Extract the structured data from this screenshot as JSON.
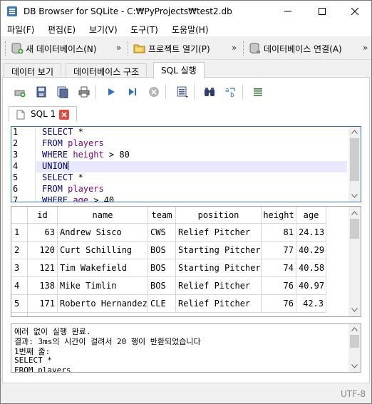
{
  "window": {
    "title": "DB Browser for SQLite - C:₩PyProjects₩test2.db"
  },
  "menu": [
    {
      "label": "파일(F)"
    },
    {
      "label": "편집(E)"
    },
    {
      "label": "보기(V)"
    },
    {
      "label": "도구(T)"
    },
    {
      "label": "도움말(H)"
    }
  ],
  "toolbar": {
    "new_db": "새 데이터베이스(N)",
    "open_project": "프로젝트 열기(P)",
    "attach_db": "데이터베이스 연결(A)",
    "overflow": "»"
  },
  "tabs": [
    {
      "label": "데이터 보기"
    },
    {
      "label": "데이터베이스 구조"
    },
    {
      "label": "SQL 실행"
    }
  ],
  "sql_tab": {
    "label": "SQL 1"
  },
  "editor": {
    "line_numbers": [
      "1",
      "2",
      "3",
      "4",
      "5",
      "6",
      "7"
    ],
    "lines": [
      {
        "kw": "SELECT",
        "rest": " *"
      },
      {
        "kw": "FROM",
        "tbl": " players"
      },
      {
        "kw": "WHERE",
        "col": " height",
        "rest": " > 80"
      },
      {
        "kw": "UNION"
      },
      {
        "kw": "SELECT",
        "rest": " *"
      },
      {
        "kw": "FROM",
        "tbl": " players"
      },
      {
        "kw": "WHERE",
        "col": " age",
        "rest": " > 40"
      }
    ]
  },
  "results": {
    "columns": [
      "id",
      "name",
      "team",
      "position",
      "height",
      "age"
    ],
    "rows": [
      {
        "num": "1",
        "id": "63",
        "name": "Andrew Sisco",
        "team": "CWS",
        "position": "Relief Pitcher",
        "height": "81",
        "age": "24.13"
      },
      {
        "num": "2",
        "id": "120",
        "name": "Curt Schilling",
        "team": "BOS",
        "position": "Starting Pitcher",
        "height": "77",
        "age": "40.29"
      },
      {
        "num": "3",
        "id": "121",
        "name": "Tim Wakefield",
        "team": "BOS",
        "position": "Starting Pitcher",
        "height": "74",
        "age": "40.58"
      },
      {
        "num": "4",
        "id": "138",
        "name": "Mike Timlin",
        "team": "BOS",
        "position": "Relief Pitcher",
        "height": "76",
        "age": "40.97"
      },
      {
        "num": "5",
        "id": "171",
        "name": "Roberto Hernandez",
        "team": "CLE",
        "position": "Relief Pitcher",
        "height": "76",
        "age": "42.3"
      }
    ]
  },
  "messages": [
    "에러 없이 실행 완료.",
    "결과: 3ms의 시간이 걸려서 20 행이 반환되었습니다",
    "1번째 줄:",
    "SELECT *",
    "FROM players"
  ],
  "status": {
    "encoding": "UTF-8"
  },
  "colors": {
    "keyword": "#00007f",
    "identifier": "#7f007f",
    "editor_border": "#2b78c6",
    "current_line": "#e8e8ff"
  }
}
